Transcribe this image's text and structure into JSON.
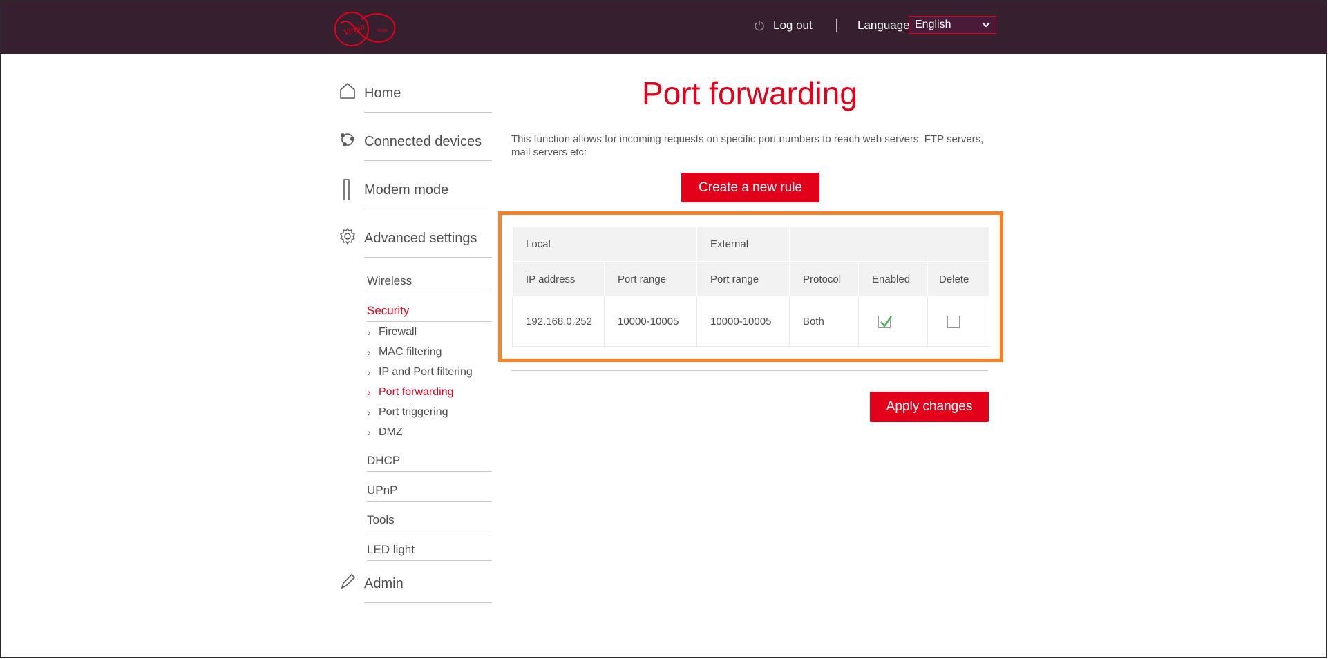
{
  "header": {
    "logout_label": "Log out",
    "language_label": "Language",
    "language_selected": "English",
    "brand_logo_text": "Virgin media"
  },
  "sidebar": {
    "main": [
      {
        "label": "Home",
        "icon": "home-icon"
      },
      {
        "label": "Connected devices",
        "icon": "devices-icon"
      },
      {
        "label": "Modem mode",
        "icon": "modem-icon"
      },
      {
        "label": "Advanced settings",
        "icon": "gear-icon"
      },
      {
        "label": "Admin",
        "icon": "pencil-icon"
      }
    ],
    "advanced_sub": [
      {
        "label": "Wireless"
      },
      {
        "label": "Security"
      },
      {
        "label": "DHCP"
      },
      {
        "label": "UPnP"
      },
      {
        "label": "Tools"
      },
      {
        "label": "LED light"
      }
    ],
    "security_items": [
      {
        "label": "Firewall"
      },
      {
        "label": "MAC filtering"
      },
      {
        "label": "IP and Port filtering"
      },
      {
        "label": "Port forwarding"
      },
      {
        "label": "Port triggering"
      },
      {
        "label": "DMZ"
      }
    ]
  },
  "main": {
    "title": "Port forwarding",
    "description": "This function allows for incoming requests on specific port numbers to reach web servers, FTP servers, mail servers etc:",
    "create_button": "Create a new rule",
    "apply_button": "Apply changes",
    "table": {
      "group_headers": [
        "Local",
        "External"
      ],
      "columns": [
        "IP address",
        "Port range",
        "Port range",
        "Protocol",
        "Enabled",
        "Delete"
      ],
      "rows": [
        {
          "ip": "192.168.0.252",
          "local_port": "10000-10005",
          "external_port": "10000-10005",
          "protocol": "Both",
          "enabled": true,
          "delete": false
        }
      ]
    }
  },
  "colors": {
    "brand_red": "#e2001a",
    "header_bg": "#36202f",
    "highlight_orange": "#f5822a"
  }
}
